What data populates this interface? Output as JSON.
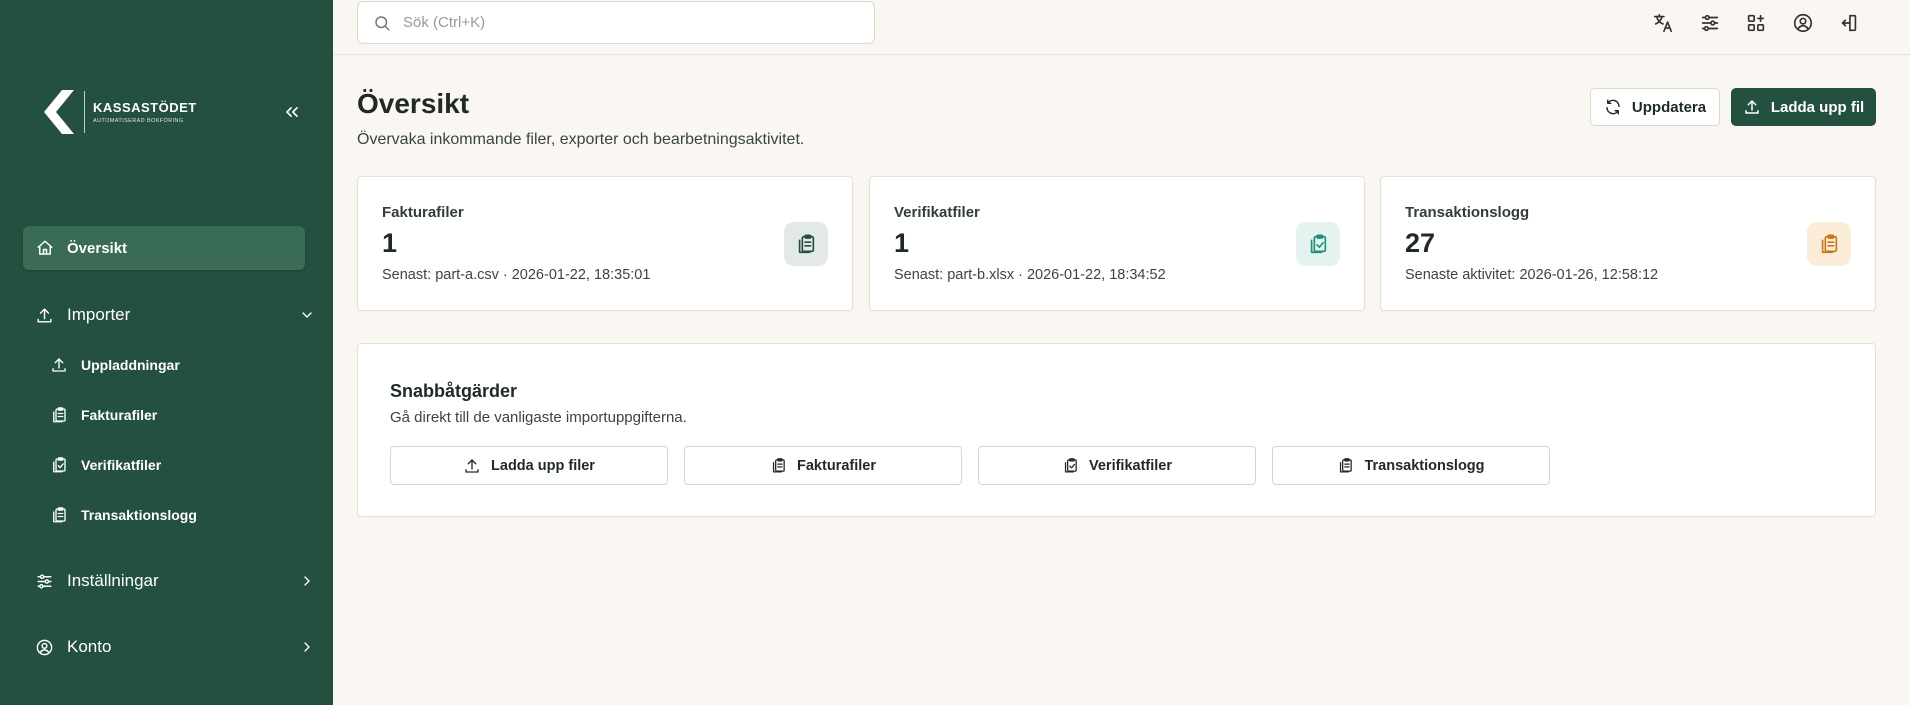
{
  "brand": {
    "name": "KASSASTÖDET",
    "tagline": "AUTOMATISERAD BOKFÖRING"
  },
  "colors": {
    "sidebar_bg": "#24503f",
    "sidebar_active": "#3a6b57",
    "primary": "#24503f",
    "page_bg": "#faf7f2"
  },
  "sidebar": {
    "collapse_icon": "double-chevron-left-icon",
    "active": {
      "label": "Översikt",
      "icon": "home-icon"
    },
    "groups": [
      {
        "label": "Importer",
        "icon": "upload-icon",
        "expanded": true
      },
      {
        "label": "Inställningar",
        "icon": "sliders-icon",
        "expanded": false
      },
      {
        "label": "Konto",
        "icon": "user-circle-icon",
        "expanded": false
      }
    ],
    "import_items": [
      {
        "label": "Uppladdningar",
        "icon": "upload-icon"
      },
      {
        "label": "Fakturafiler",
        "icon": "clipboard-copy-icon"
      },
      {
        "label": "Verifikatfiler",
        "icon": "clipboard-check-icon"
      },
      {
        "label": "Transaktionslogg",
        "icon": "clipboard-copy-icon"
      }
    ]
  },
  "topbar": {
    "search_placeholder": "Sök (Ctrl+K)",
    "icons": [
      "language-icon",
      "sliders-icon",
      "apps-icon",
      "user-circle-icon",
      "logout-icon"
    ]
  },
  "page": {
    "title": "Översikt",
    "subtitle": "Övervaka inkommande filer, exporter och bearbetningsaktivitet.",
    "refresh_label": "Uppdatera",
    "upload_label": "Ladda upp fil"
  },
  "cards": [
    {
      "title": "Fakturafiler",
      "value": "1",
      "meta": "Senast: part-a.csv · 2026-01-22, 18:35:01",
      "icon": "clipboard-copy-icon",
      "icon_bg": "#e3e9e6",
      "icon_color": "#24503f"
    },
    {
      "title": "Verifikatfiler",
      "value": "1",
      "meta": "Senast: part-b.xlsx · 2026-01-22, 18:34:52",
      "icon": "clipboard-check-icon",
      "icon_bg": "#e4f3ef",
      "icon_color": "#1f8f7a"
    },
    {
      "title": "Transaktionslogg",
      "value": "27",
      "meta": "Senaste aktivitet: 2026-01-26, 12:58:12",
      "icon": "clipboard-copy-icon",
      "icon_bg": "#fbecd7",
      "icon_color": "#c8771d"
    }
  ],
  "quick": {
    "title": "Snabbåtgärder",
    "subtitle": "Gå direkt till de vanligaste importuppgifterna.",
    "buttons": [
      {
        "label": "Ladda upp filer",
        "icon": "upload-icon"
      },
      {
        "label": "Fakturafiler",
        "icon": "clipboard-copy-icon"
      },
      {
        "label": "Verifikatfiler",
        "icon": "clipboard-check-icon"
      },
      {
        "label": "Transaktionslogg",
        "icon": "clipboard-copy-icon"
      }
    ]
  }
}
